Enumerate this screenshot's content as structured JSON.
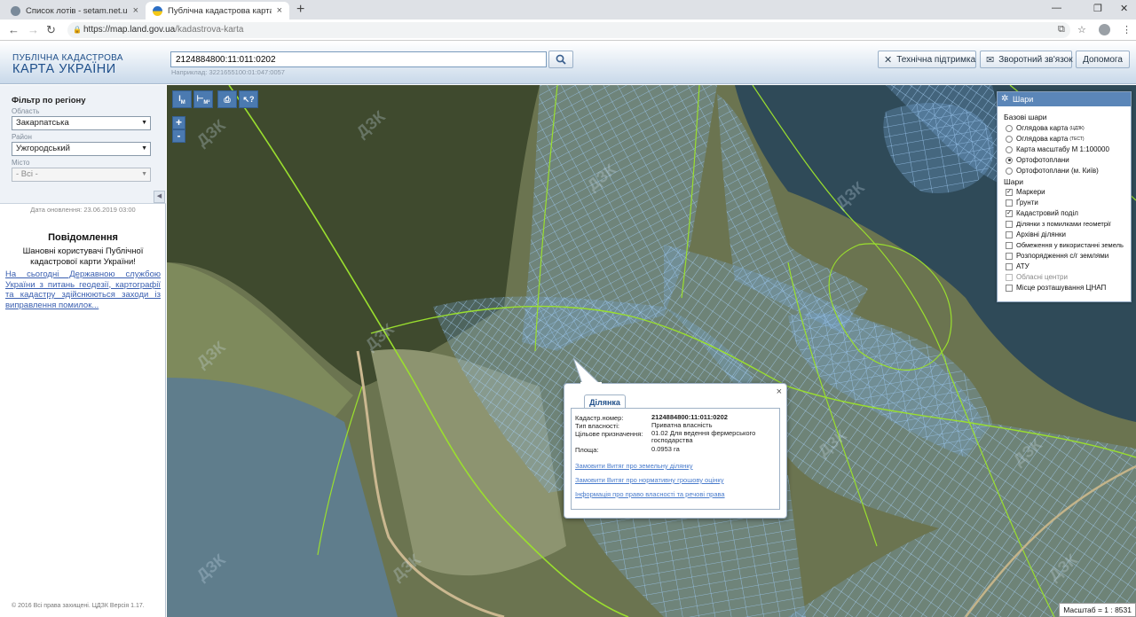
{
  "browser": {
    "tabs": [
      {
        "title": "Список лотів - setam.net.ua",
        "active": false
      },
      {
        "title": "Публічна кадастрова карта Укр",
        "active": true
      }
    ],
    "url_host": "https://map.land.gov.ua",
    "url_path": "/kadastrova-karta"
  },
  "header": {
    "logo_line1": "ПУБЛІЧНА КАДАСТРОВА",
    "logo_line2": "КАРТА УКРАЇНИ",
    "search_value": "2124884800:11:011:0202",
    "search_hint": "Наприклад: 3221655100:01:047:0057",
    "buttons": {
      "support": "Технічна підтримка",
      "feedback": "Зворотний зв'язок",
      "help": "Допомога"
    }
  },
  "sidebar": {
    "filter_title": "Фільтр по регіону",
    "region_label": "Область",
    "region_value": "Закарпатська",
    "district_label": "Район",
    "district_value": "Ужгородський",
    "city_label": "Місто",
    "city_value": "- Всі -",
    "updated": "Дата оновлення: 23.06.2019 03:00",
    "message_title": "Повідомлення",
    "message_text": "Шановні користувачі Публічної кадастрової карти України!",
    "message_link": "На сьогодні Державною службою України з питань геодезії, картографії та кадастру здійснюються заходи із виправлення помилок...",
    "copyright": "© 2016 Всі права захищені. ЦДЗК Версія 1.17."
  },
  "map": {
    "zoom_in": "+",
    "zoom_out": "-",
    "scale_label": "Масштаб = 1 : 8531",
    "watermark": "ДЗК"
  },
  "layers": {
    "title": "Шари",
    "base_title": "Базові шари",
    "base": [
      {
        "label": "Оглядова карта",
        "sup": "(ЦДЗК)",
        "selected": false
      },
      {
        "label": "Оглядова карта",
        "sup": "(ТЕСТ)",
        "selected": false
      },
      {
        "label": "Карта масштабу М 1:100000",
        "sup": "",
        "selected": false
      },
      {
        "label": "Ортофотоплани",
        "sup": "",
        "selected": true
      },
      {
        "label": "Ортофотоплани (м. Київ)",
        "sup": "",
        "selected": false
      }
    ],
    "overlay_title": "Шари",
    "overlays": [
      {
        "label": "Маркери",
        "checked": true,
        "disabled": false
      },
      {
        "label": "Ґрунти",
        "checked": false,
        "disabled": false
      },
      {
        "label": "Кадастровий поділ",
        "checked": true,
        "disabled": false
      },
      {
        "label": "Ділянки з помилками геометрії",
        "checked": false,
        "disabled": false
      },
      {
        "label": "Архівні ділянки",
        "checked": false,
        "disabled": false
      },
      {
        "label": "Обмеження у використанні земель",
        "checked": false,
        "disabled": false
      },
      {
        "label": "Розпорядження с/г землями",
        "checked": false,
        "disabled": false
      },
      {
        "label": "АТУ",
        "checked": false,
        "disabled": false
      },
      {
        "label": "Обласні центри",
        "checked": false,
        "disabled": true
      },
      {
        "label": "Місце розташування ЦНАП",
        "checked": false,
        "disabled": false
      }
    ]
  },
  "popup": {
    "tab": "Ділянка",
    "rows": [
      {
        "key": "Кадастр.номер:",
        "value": "2124884800:11:011:0202",
        "bold": true
      },
      {
        "key": "Тип власності:",
        "value": "Приватна власність",
        "bold": false
      },
      {
        "key": "Цільове призначення:",
        "value": "01.02 Для ведення фермерського господарства",
        "bold": false
      },
      {
        "key": "Площа:",
        "value": "0.0953 га",
        "bold": false
      }
    ],
    "links": [
      "Замовити Витяг про земельну ділянку",
      "Замовити Витяг про нормативну грошову оцінку",
      "Інформація про право власності та речові права"
    ]
  }
}
